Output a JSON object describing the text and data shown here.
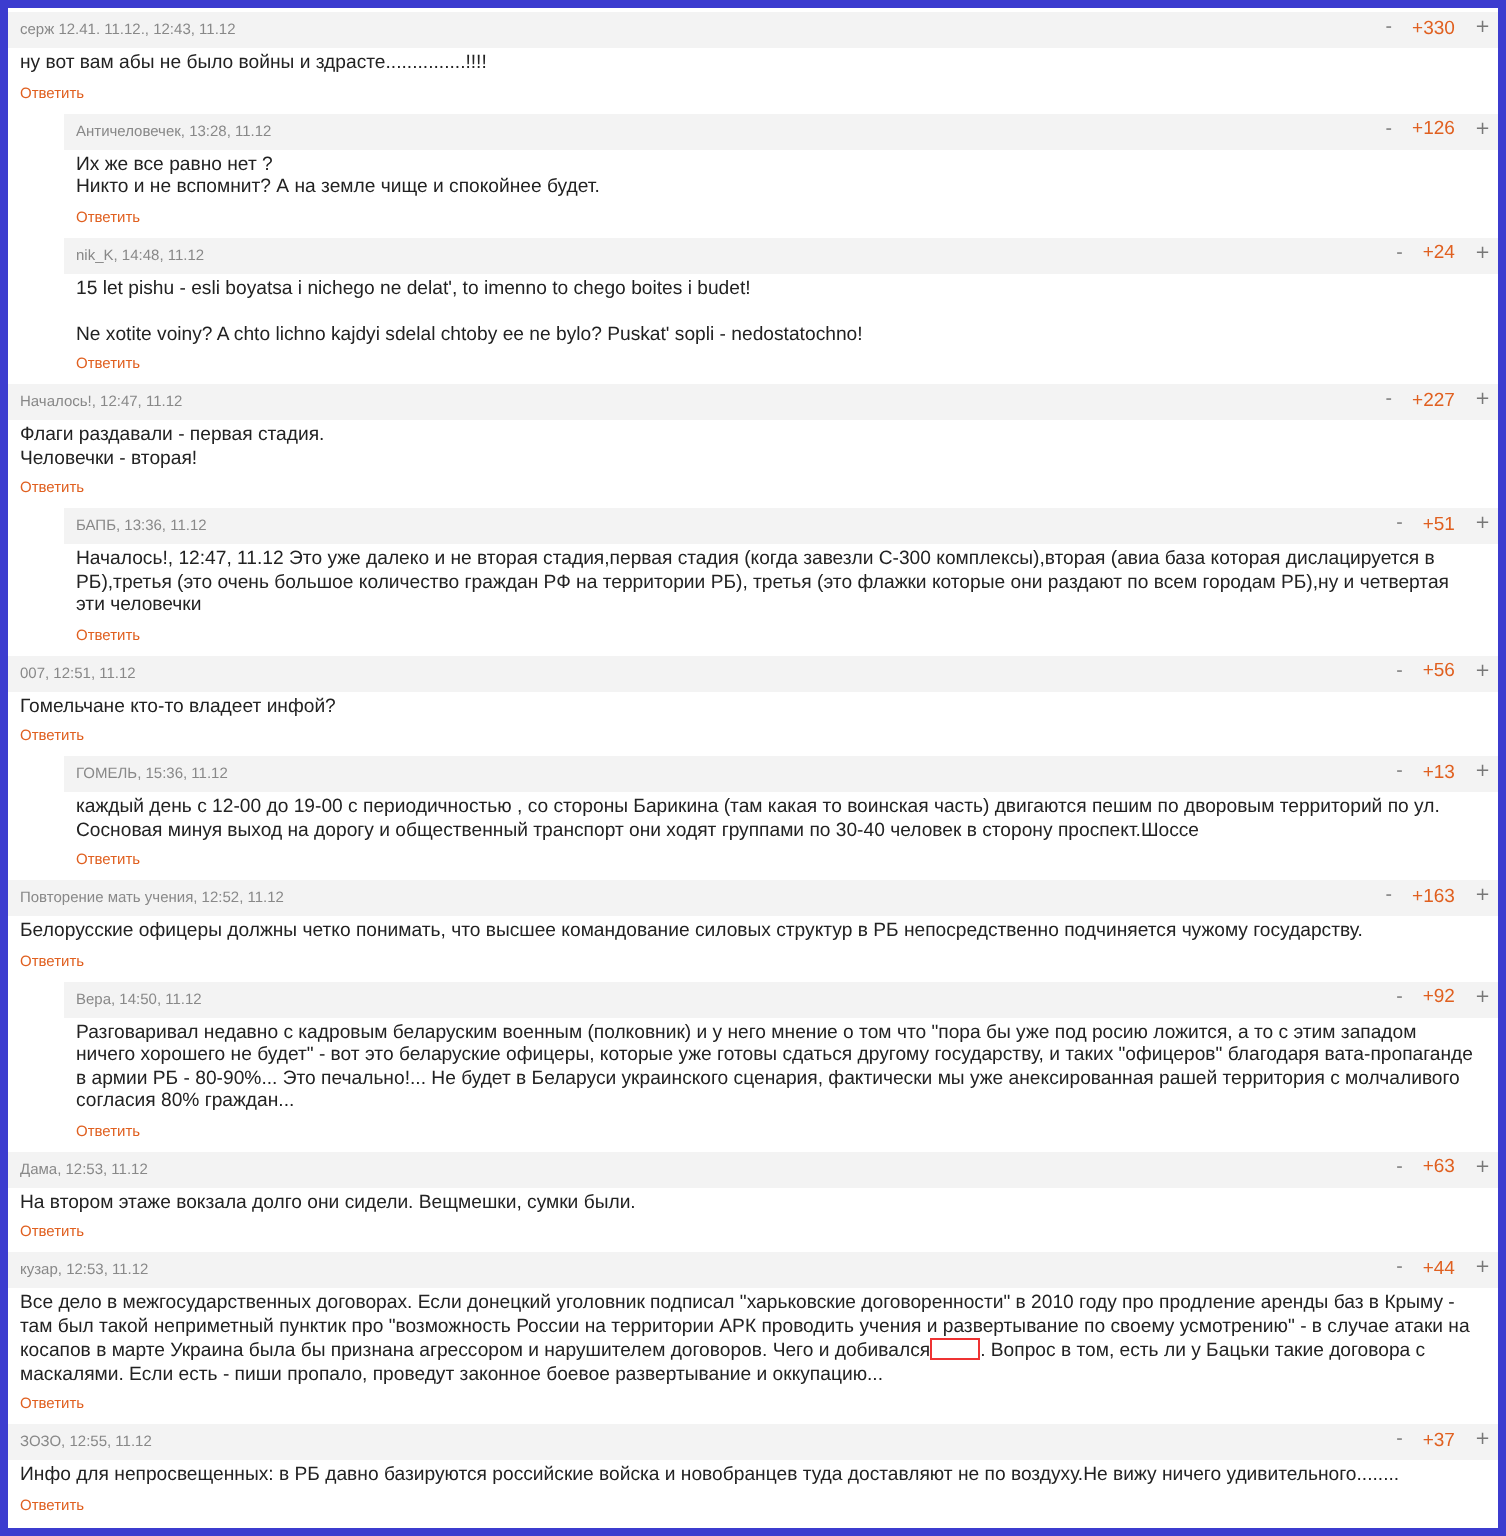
{
  "comments": [
    {
      "meta": "серж 12.41. 11.12., 12:43, 11.12",
      "vote_down": "-",
      "score": "+330",
      "vote_up": "+",
      "text": "ну вот вам абы не было войны и здрасте...............!!!!",
      "reply": "Ответить",
      "children": [
        {
          "meta": "Античеловечек, 13:28, 11.12",
          "vote_down": "-",
          "score": "+126",
          "vote_up": "+",
          "text": "Их же все равно нет ?\nНикто и не вспомнит? А на земле чище и спокойнее будет.",
          "reply": "Ответить"
        },
        {
          "meta": "nik_K, 14:48, 11.12",
          "vote_down": "-",
          "score": "+24",
          "vote_up": "+",
          "text": "15 let pishu - esli boyatsa i nichego ne delat', to imenno to chego boites i budet!\n\nNe xotite voiny? A chto lichno kajdyi sdelal chtoby ee ne bylo? Puskat' sopli - nedostatochno!",
          "reply": "Ответить"
        }
      ]
    },
    {
      "meta": "Началось!, 12:47, 11.12",
      "vote_down": "-",
      "score": "+227",
      "vote_up": "+",
      "text": "Флаги раздавали - первая стадия.\nЧеловечки - вторая!",
      "reply": "Ответить",
      "children": [
        {
          "meta": "БАПБ, 13:36, 11.12",
          "vote_down": "-",
          "score": "+51",
          "vote_up": "+",
          "text": "Началось!, 12:47, 11.12 Это уже далеко и не вторая стадия,первая стадия (когда завезли С-300 комплексы),вторая (авиа база которая дислацируется в РБ),третья (это очень большое количество граждан РФ на территории РБ), третья (это флажки которые они раздают по всем городам РБ),ну и четвертая эти человечки",
          "reply": "Ответить"
        }
      ]
    },
    {
      "meta": "007, 12:51, 11.12",
      "vote_down": "-",
      "score": "+56",
      "vote_up": "+",
      "text": "Гомельчане кто-то владеет инфой?",
      "reply": "Ответить",
      "children": [
        {
          "meta": "ГОМЕЛЬ, 15:36, 11.12",
          "vote_down": "-",
          "score": "+13",
          "vote_up": "+",
          "text": "каждый день с 12-00 до 19-00 с периодичностью , со стороны Барикина (там какая то воинская часть) двигаются пешим по дворовым территорий по ул. Сосновая минуя выход на дорогу и общественный транспорт они ходят группами по 30-40 человек в сторону проспект.Шоссе",
          "reply": "Ответить"
        }
      ]
    },
    {
      "meta": "Повторение мать учения, 12:52, 11.12",
      "vote_down": "-",
      "score": "+163",
      "vote_up": "+",
      "text": "Белорусские офицеры должны четко понимать, что высшее командование силовых структур в РБ непосредственно подчиняется чужому государству.",
      "reply": "Ответить",
      "children": [
        {
          "meta": "Вера, 14:50, 11.12",
          "vote_down": "-",
          "score": "+92",
          "vote_up": "+",
          "text": "Разговаривал недавно с кадровым беларуским военным (полковник) и у него мнение о том что \"пора бы уже под росию ложится, а то с этим западом ничего хорошего не будет\" - вот это беларуские офицеры, которые уже готовы сдаться другому государству, и таких \"офицеров\" благодаря вата-пропаганде в армии РБ - 80-90%... Это печально!... Не будет в Беларуси украинского сценария, фактически мы уже анексированная рашей территория с молчаливого согласия 80% граждан...",
          "reply": "Ответить"
        }
      ]
    },
    {
      "meta": "Дама, 12:53, 11.12",
      "vote_down": "-",
      "score": "+63",
      "vote_up": "+",
      "text": "На втором этаже вокзала долго они сидели. Вещмешки, сумки были.",
      "reply": "Ответить"
    },
    {
      "meta": "кузар, 12:53, 11.12",
      "vote_down": "-",
      "score": "+44",
      "vote_up": "+",
      "segments": [
        {
          "kind": "text",
          "text": "Все дело в межгосударственных договорах. Если донецкий уголовник подписал \"харьковские договоренности\" в 2010 году про продление аренды баз в Крыму - там был такой неприметный пунктик про \"возможность России на территории АРК проводить учения и развертывание по своему усмотрению\" - в случае атаки на косапов в марте Украина была бы признана агрессором и нарушителем договоров. Чего и добивался"
        },
        {
          "kind": "redacted"
        },
        {
          "kind": "text",
          "text": ". Вопрос в том, есть ли у Бацьки такие договора с маскалями. Если есть - пиши пропало, проведут законное боевое развертывание и оккупацию..."
        }
      ],
      "reply": "Ответить"
    },
    {
      "meta": "ЗОЗО, 12:55, 11.12",
      "vote_down": "-",
      "score": "+37",
      "vote_up": "+",
      "text": "Инфо для непросвещенных: в РБ давно базируются российские войска и новобранцев туда доставляют не по воздуху.Не вижу ничего удивительного........",
      "reply": "Ответить"
    }
  ]
}
